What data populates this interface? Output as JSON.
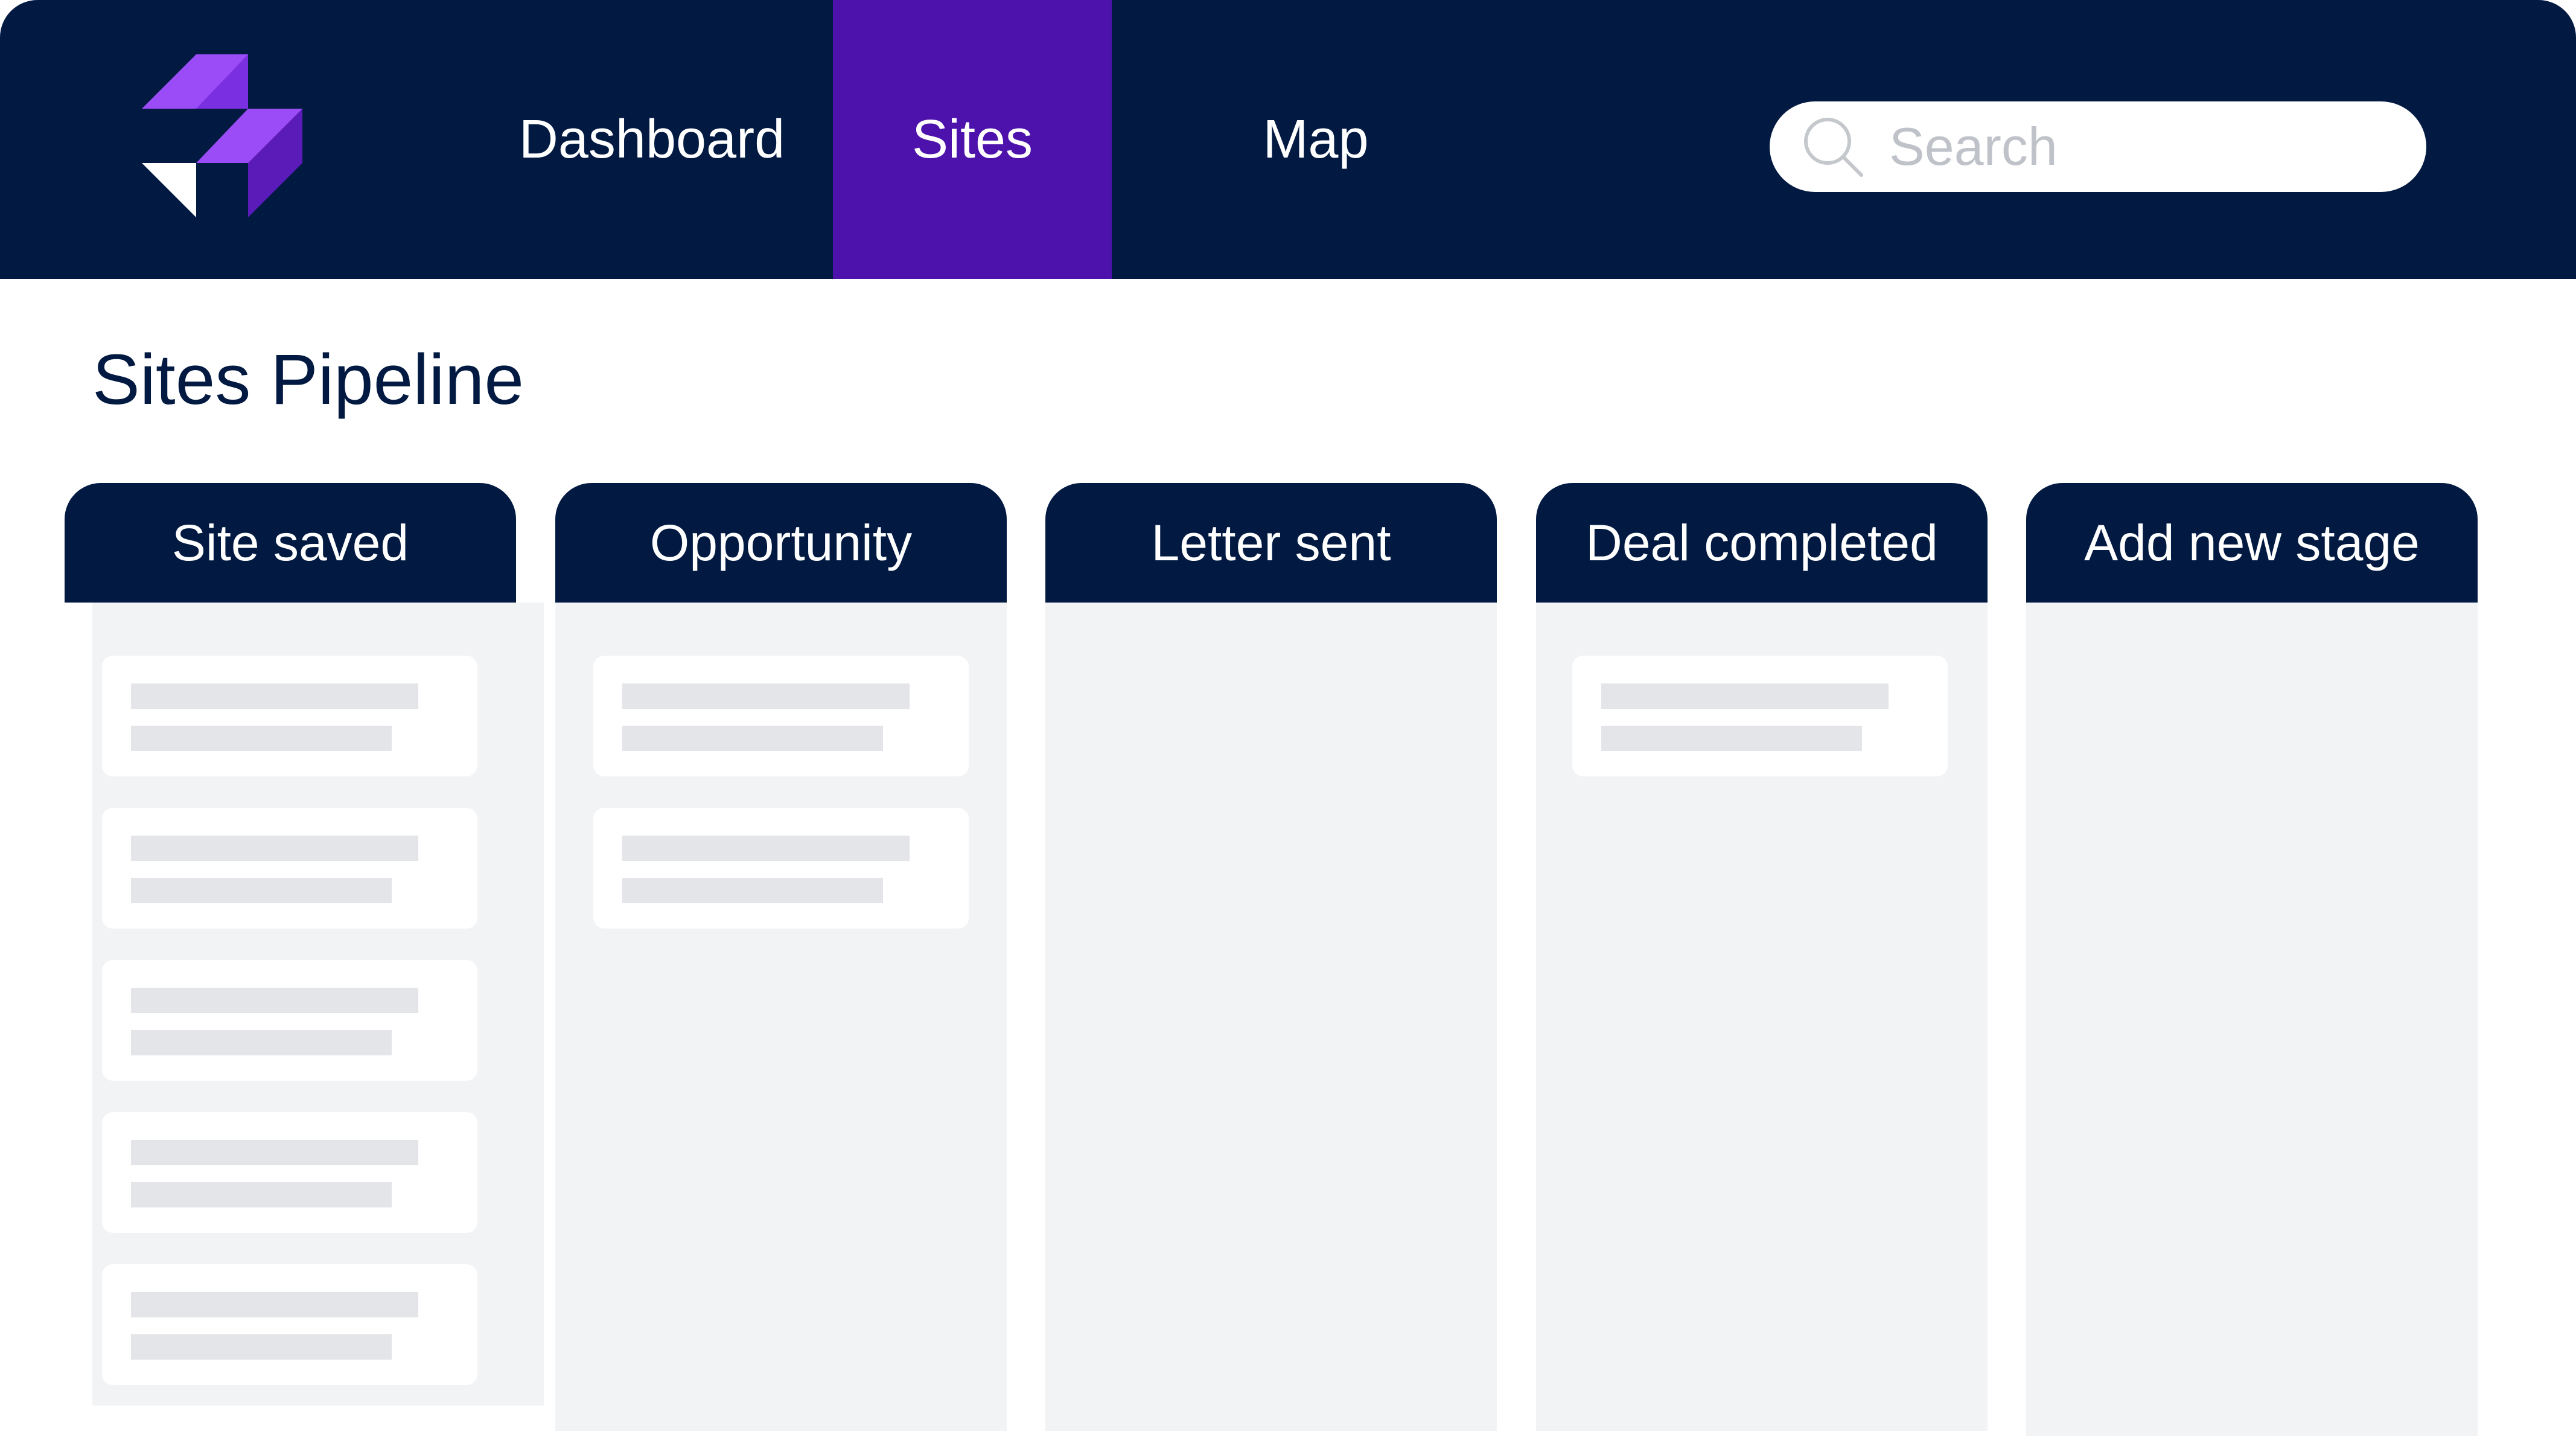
{
  "nav": {
    "items": [
      {
        "label": "Dashboard",
        "active": false
      },
      {
        "label": "Sites",
        "active": true
      },
      {
        "label": "Map",
        "active": false
      }
    ],
    "search_placeholder": "Search"
  },
  "page": {
    "title": "Sites Pipeline"
  },
  "columns": [
    {
      "label": "Site saved",
      "card_count": 5
    },
    {
      "label": "Opportunity",
      "card_count": 2
    },
    {
      "label": "Letter sent",
      "card_count": 0
    },
    {
      "label": "Deal completed",
      "card_count": 1
    },
    {
      "label": "Add new stage",
      "card_count": 0
    }
  ],
  "colors": {
    "navbar": "#021a42",
    "active_tab": "#4c12ab",
    "logo_purple_light": "#9b4cf7",
    "logo_purple_dark": "#5a1bb8",
    "column_body": "#f2f3f5",
    "card": "#ffffff",
    "card_placeholder_bar": "#e4e5e8"
  }
}
